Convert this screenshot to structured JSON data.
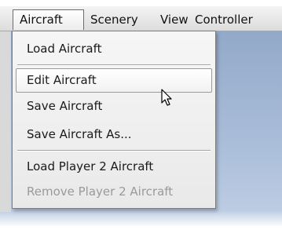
{
  "menubar": {
    "items": [
      {
        "label": "Aircraft",
        "active": true
      },
      {
        "label": "Scenery",
        "active": false
      },
      {
        "label": "View",
        "active": false
      },
      {
        "label": "Controller",
        "active": false
      }
    ]
  },
  "dropdown": {
    "items": [
      {
        "label": "Load Aircraft",
        "state": "normal"
      },
      {
        "label": "Edit Aircraft",
        "state": "hover"
      },
      {
        "label": "Save Aircraft",
        "state": "normal"
      },
      {
        "label": "Save Aircraft As...",
        "state": "normal"
      },
      {
        "label": "Load Player 2 Aircraft",
        "state": "normal"
      },
      {
        "label": "Remove Player 2 Aircraft",
        "state": "disabled"
      }
    ]
  },
  "cursor": {
    "icon": "mouse-pointer-icon"
  },
  "colors": {
    "desktop_top": "#93a9c9",
    "desktop_bottom": "#c1d0e5",
    "menu_bg": "#eeeeee",
    "disabled_text": "#9a9a9a"
  }
}
